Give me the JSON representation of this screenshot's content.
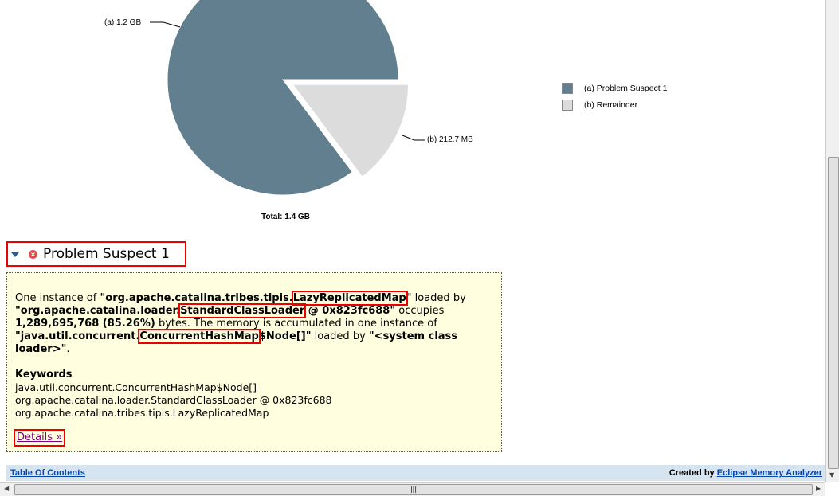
{
  "chart_data": {
    "type": "pie",
    "total_label": "Total: 1.4 GB",
    "slices": [
      {
        "label": "(a)  1.2 GB",
        "legend": "(a)  Problem Suspect 1",
        "value": 85.26,
        "color": "#617f8f",
        "exploded": false
      },
      {
        "label": "(b)  212.7 MB",
        "legend": "(b)  Remainder",
        "value": 14.74,
        "color": "#dcdcdc",
        "exploded": true
      }
    ]
  },
  "suspect": {
    "title": "Problem Suspect 1",
    "desc": {
      "t1": "One instance of ",
      "b1": "\"org.apache.catalina.tribes.tipis.",
      "h1": "LazyReplicatedMap",
      "b1e": "\"",
      "t2": " loaded by ",
      "b2": "\"org.apache.catalina.loader.",
      "h2": "StandardClassLoader",
      "b2e": " @ 0x823fc688\"",
      "t3": " occupies ",
      "b3": "1,289,695,768 (85.26%)",
      "t4": " bytes. The memory is accumulated in one instance of ",
      "b4": "\"java.util.concurrent.",
      "h3": "ConcurrentHashMap",
      "b4e": "$Node[]\"",
      "t5": " loaded by ",
      "b5": "\"<system class loader>\"",
      "t6": "."
    },
    "keywords_title": "Keywords",
    "keywords": [
      "java.util.concurrent.ConcurrentHashMap$Node[]",
      "org.apache.catalina.loader.StandardClassLoader @ 0x823fc688",
      "org.apache.catalina.tribes.tipis.LazyReplicatedMap"
    ],
    "details_link": "Details »"
  },
  "footer": {
    "toc": "Table Of Contents",
    "created_by": "Created by ",
    "app": "Eclipse Memory Analyzer"
  }
}
